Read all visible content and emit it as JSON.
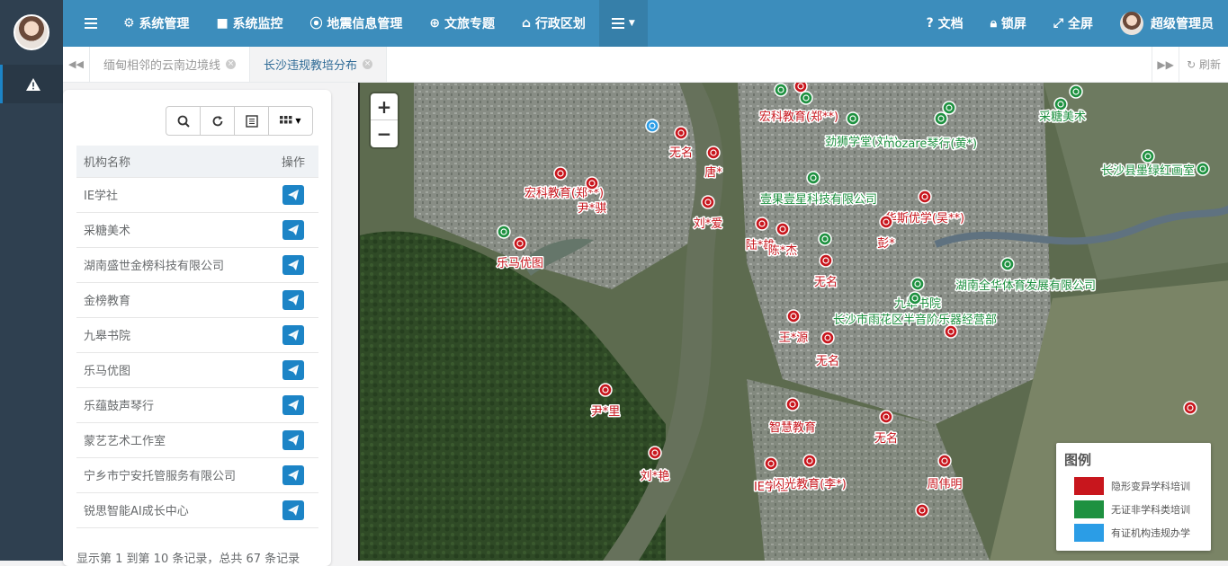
{
  "topbar": {
    "menus": [
      "系统管理",
      "系统监控",
      "地震信息管理",
      "文旅专题",
      "行政区划"
    ],
    "right": [
      "文档",
      "锁屏",
      "全屏"
    ],
    "user": "超级管理员"
  },
  "tabs": [
    {
      "label": "缅甸相邻的云南边境线",
      "active": false
    },
    {
      "label": "长沙违规教培分布",
      "active": true
    }
  ],
  "refresh_label": "刷新",
  "list": {
    "col_name": "机构名称",
    "col_op": "操作",
    "rows": [
      "IE学社",
      "采糖美术",
      "湖南盛世金榜科技有限公司",
      "金榜教育",
      "九皋书院",
      "乐马优图",
      "乐蕴鼓声琴行",
      "蒙艺艺术工作室",
      "宁乡市宁安托管服务有限公司",
      "锐思智能AI成长中心"
    ],
    "footer": "显示第 1 到第 10 条记录，总共 67 条记录"
  },
  "legend": {
    "title": "图例",
    "items": [
      {
        "label": "隐形变异学科培训",
        "color": "#c8161d"
      },
      {
        "label": "无证非学科类培训",
        "color": "#1e9140"
      },
      {
        "label": "有证机构违规办学",
        "color": "#2b9de6"
      }
    ]
  },
  "markers": {
    "red": [
      {
        "label": "宏科教育(郑**)"
      },
      {
        "label": "无名"
      },
      {
        "label": "唐*"
      },
      {
        "label": "宏科教育(郑**)"
      },
      {
        "label": "尹*骐"
      },
      {
        "label": "刘*爱"
      },
      {
        "label": "乐马优图"
      },
      {
        "label": "华斯优学(吴**)"
      },
      {
        "label": "彭*"
      },
      {
        "label": "陆*雄"
      },
      {
        "label": "陈*杰"
      },
      {
        "label": "无名"
      },
      {
        "label": "王*源"
      },
      {
        "label": "无名"
      },
      {
        "label": "尹*里"
      },
      {
        "label": "智慧教育"
      },
      {
        "label": "无名"
      },
      {
        "label": "刘*艳"
      },
      {
        "label": "IE学社"
      },
      {
        "label": "闪光教育(李*)"
      },
      {
        "label": "周伟明"
      },
      {
        "label": ""
      },
      {
        "label": ""
      },
      {
        "label": ""
      }
    ],
    "green": [
      {
        "label": "劲狮学堂(刘*)"
      },
      {
        "label": "mozare琴行(黄*)"
      },
      {
        "label": "采糖美术"
      },
      {
        "label": "长沙县墨绿红画室"
      },
      {
        "label": "壹果壹星科技有限公司"
      },
      {
        "label": "湖南全华体育发展有限公司"
      },
      {
        "label": "九皋书院"
      },
      {
        "label": "长沙市雨花区半音阶乐器经营部"
      },
      {
        "label": ""
      },
      {
        "label": ""
      },
      {
        "label": ""
      },
      {
        "label": ""
      },
      {
        "label": ""
      },
      {
        "label": ""
      },
      {
        "label": ""
      }
    ],
    "blue": [
      {
        "label": ""
      }
    ]
  }
}
